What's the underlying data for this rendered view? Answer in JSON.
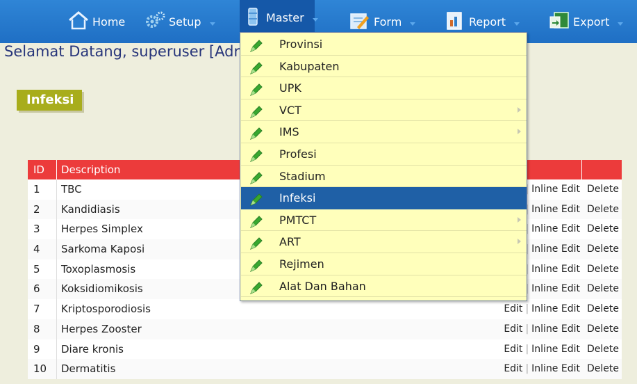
{
  "nav": {
    "items": [
      {
        "label": "Home",
        "icon": "home-icon"
      },
      {
        "label": "Setup",
        "icon": "gear-icon"
      },
      {
        "label": "Master",
        "icon": "database-icon"
      },
      {
        "label": "Form",
        "icon": "form-pencil-icon"
      },
      {
        "label": "Report",
        "icon": "report-icon"
      },
      {
        "label": "Export",
        "icon": "export-icon"
      }
    ],
    "active": "Master"
  },
  "welcome": "Selamat Datang, superuser [Adr",
  "page_title": "Infeksi",
  "table": {
    "headers": {
      "id": "ID",
      "description": "Description"
    },
    "rows": [
      {
        "id": "1",
        "description": "TBC"
      },
      {
        "id": "2",
        "description": "Kandidiasis"
      },
      {
        "id": "3",
        "description": "Herpes Simplex"
      },
      {
        "id": "4",
        "description": "Sarkoma Kaposi"
      },
      {
        "id": "5",
        "description": "Toxoplasmosis"
      },
      {
        "id": "6",
        "description": "Koksidiomikosis"
      },
      {
        "id": "7",
        "description": "Kriptosporodiosis"
      },
      {
        "id": "8",
        "description": "Herpes Zooster"
      },
      {
        "id": "9",
        "description": "Diare kronis"
      },
      {
        "id": "10",
        "description": "Dermatitis"
      }
    ],
    "actions": {
      "edit": "Edit",
      "separator": "|",
      "inline_edit": "Inline Edit",
      "delete": "Delete"
    }
  },
  "dropdown": {
    "items": [
      {
        "label": "Provinsi",
        "submenu": false
      },
      {
        "label": "Kabupaten",
        "submenu": false
      },
      {
        "label": "UPK",
        "submenu": false
      },
      {
        "label": "VCT",
        "submenu": true
      },
      {
        "label": "IMS",
        "submenu": true
      },
      {
        "label": "Profesi",
        "submenu": false
      },
      {
        "label": "Stadium",
        "submenu": false
      },
      {
        "label": "Infeksi",
        "submenu": false
      },
      {
        "label": "PMTCT",
        "submenu": true
      },
      {
        "label": "ART",
        "submenu": true
      },
      {
        "label": "Rejimen",
        "submenu": false
      },
      {
        "label": "Alat Dan Bahan",
        "submenu": false
      }
    ],
    "selected": "Infeksi",
    "item_icon": "pencil-icon"
  },
  "colors": {
    "nav_bar": "#1f6fc4",
    "page_bg": "#eeeedd",
    "table_header": "#ec3b3b",
    "title_box": "#a8ad1c",
    "menu_bg": "#ffffbb",
    "menu_selected": "#1f60a6",
    "welcome_text": "#27357a"
  }
}
